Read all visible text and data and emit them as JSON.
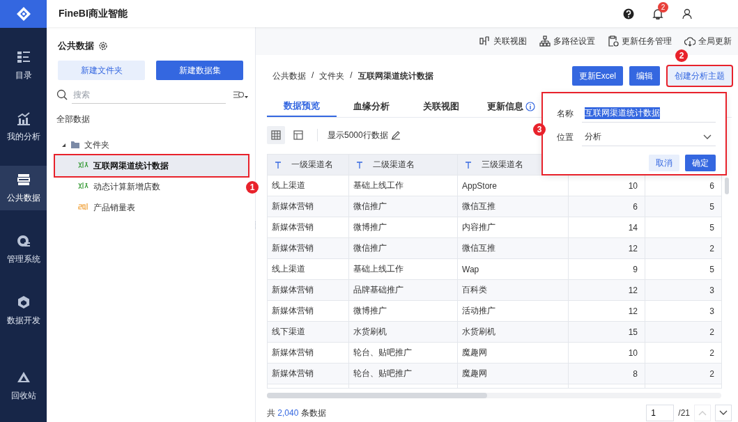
{
  "app": {
    "title": "FineBI商业智能",
    "notification_badge": "2"
  },
  "nav": [
    {
      "label": "目录",
      "kind": "catalog",
      "selected": false
    },
    {
      "label": "我的分析",
      "kind": "analysis",
      "selected": false
    },
    {
      "label": "公共数据",
      "kind": "data",
      "selected": true
    },
    {
      "label": "管理系统",
      "kind": "system",
      "selected": false
    },
    {
      "label": "数据开发",
      "kind": "dev",
      "selected": false
    },
    {
      "label": "回收站",
      "kind": "recycle",
      "selected": false
    }
  ],
  "left_panel": {
    "title": "公共数据",
    "buttons": [
      {
        "label": "新建文件夹",
        "kind": "secondary"
      },
      {
        "label": "新建数据集",
        "kind": "primary"
      }
    ],
    "search": {
      "placeholder": "搜索"
    },
    "root": "全部数据",
    "tree": [
      {
        "label": "文件夹",
        "kind": "folder",
        "expanded": true,
        "selected": false,
        "children": [
          {
            "label": "互联网渠道统计数据",
            "kind": "xls",
            "selected": true,
            "annotation": "1"
          },
          {
            "label": "动态计算新增店数",
            "kind": "xls",
            "selected": false
          },
          {
            "label": "产品销量表",
            "kind": "sql",
            "selected": false
          }
        ]
      }
    ]
  },
  "toolbar": [
    {
      "label": "关联视图",
      "kind": "relation"
    },
    {
      "label": "多路径设置",
      "kind": "paths"
    },
    {
      "label": "更新任务管理",
      "kind": "tasks"
    },
    {
      "label": "全局更新",
      "kind": "cloud"
    }
  ],
  "breadcrumb": {
    "items": [
      "公共数据",
      "文件夹",
      "互联网渠道统计数据"
    ],
    "separator": "/"
  },
  "actions": [
    {
      "label": "更新Excel",
      "kind": "primary"
    },
    {
      "label": "编辑",
      "kind": "primary"
    },
    {
      "label": "创建分析主题",
      "kind": "secondary",
      "annotation": "2"
    }
  ],
  "tabs": [
    {
      "label": "数据预览",
      "selected": true,
      "info": false
    },
    {
      "label": "血缘分析",
      "selected": false,
      "info": false
    },
    {
      "label": "关联视图",
      "selected": false,
      "info": false
    },
    {
      "label": "更新信息",
      "selected": false,
      "info": true
    }
  ],
  "view": {
    "modes": [
      {
        "kind": "grid",
        "selected": true
      },
      {
        "kind": "layout",
        "selected": false
      }
    ],
    "row_limit": "显示5000行数据"
  },
  "table": {
    "columns": [
      "一级渠道名",
      "二级渠道名",
      "三级渠道名"
    ],
    "rows": [
      [
        "线上渠道",
        "基础上线工作",
        "AppStore",
        "10",
        "6"
      ],
      [
        "新媒体营销",
        "微信推广",
        "微信互推",
        "6",
        "5"
      ],
      [
        "新媒体营销",
        "微博推广",
        "内容推广",
        "14",
        "5"
      ],
      [
        "新媒体营销",
        "微信推广",
        "微信互推",
        "12",
        "2"
      ],
      [
        "线上渠道",
        "基础上线工作",
        "Wap",
        "9",
        "5"
      ],
      [
        "新媒体营销",
        "品牌基础推广",
        "百科类",
        "12",
        "3"
      ],
      [
        "新媒体营销",
        "微博推广",
        "活动推广",
        "12",
        "3"
      ],
      [
        "线下渠道",
        "水货刷机",
        "水货刷机",
        "15",
        "2"
      ],
      [
        "新媒体营销",
        "轮台、贴吧推广",
        "魔趣网",
        "10",
        "2"
      ],
      [
        "新媒体营销",
        "轮台、贴吧推广",
        "魔趣网",
        "8",
        "2"
      ]
    ]
  },
  "footer": {
    "total_prefix": "共",
    "total": "2,040",
    "total_suffix": "条数据",
    "page": "1",
    "pages": "/21"
  },
  "popup": {
    "annotation": "3",
    "fields": [
      {
        "label": "名称",
        "kind": "text",
        "value": "互联网渠道统计数据",
        "selected": true
      },
      {
        "label": "位置",
        "kind": "select",
        "value": "分析"
      }
    ],
    "buttons": [
      {
        "label": "取消",
        "kind": "secondary"
      },
      {
        "label": "确定",
        "kind": "primary"
      }
    ]
  }
}
